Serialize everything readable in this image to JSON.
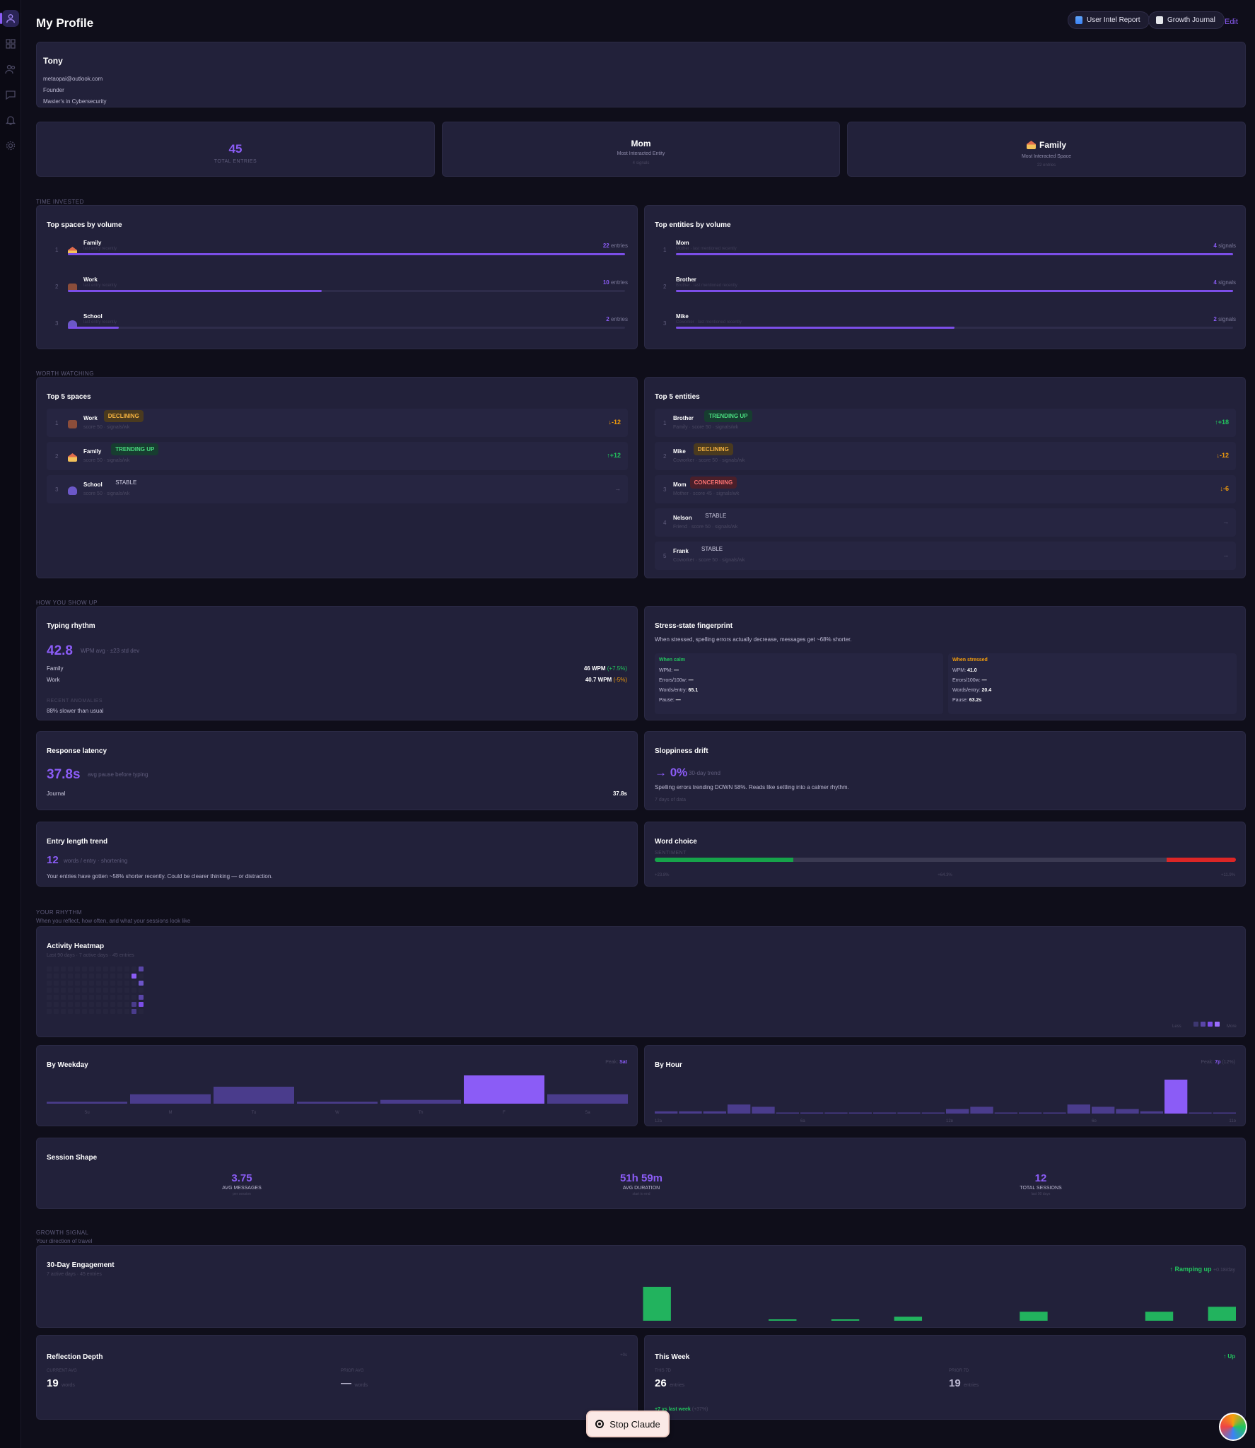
{
  "header": {
    "title": "My Profile",
    "buttons": [
      {
        "label": "User Intel Report"
      },
      {
        "label": "Growth Journal"
      }
    ],
    "edit_label": "Edit"
  },
  "profile": {
    "name": "Tony",
    "email": "metaopai@outlook.com",
    "role": "Founder",
    "education": "Master's in Cybersecurity"
  },
  "stats": [
    {
      "value": "45",
      "label": "TOTAL ENTRIES",
      "sub": ""
    },
    {
      "value": "Mom",
      "label": "Most Interacted Entity",
      "sub": "4 signals"
    },
    {
      "value": "Family",
      "label": "Most Interacted Space",
      "sub": "22 entries"
    }
  ],
  "time_invested": {
    "section_label": "TIME INVESTED",
    "spaces": {
      "title": "Top spaces by volume",
      "items": [
        {
          "rank": "1",
          "name": "Family",
          "sub": "last entry recently",
          "count": "22",
          "unit": "entries",
          "fraction": 1.0
        },
        {
          "rank": "2",
          "name": "Work",
          "sub": "last entry recently",
          "count": "10",
          "unit": "entries",
          "fraction": 0.455
        },
        {
          "rank": "3",
          "name": "School",
          "sub": "last entry recently",
          "count": "2",
          "unit": "entries",
          "fraction": 0.091
        }
      ]
    },
    "entities": {
      "title": "Top entities by volume",
      "items": [
        {
          "rank": "1",
          "name": "Mom",
          "sub": "Mother · last mentioned recently",
          "count": "4",
          "unit": "signals",
          "fraction": 1.0
        },
        {
          "rank": "2",
          "name": "Brother",
          "sub": "Brother · last mentioned recently",
          "count": "4",
          "unit": "signals",
          "fraction": 1.0
        },
        {
          "rank": "3",
          "name": "Mike",
          "sub": "Coworker · last mentioned recently",
          "count": "2",
          "unit": "signals",
          "fraction": 0.5
        }
      ]
    }
  },
  "worth_watching": {
    "section_label": "WORTH WATCHING",
    "spaces": {
      "title": "Top 5 spaces",
      "items": [
        {
          "rank": "1",
          "name": "Work",
          "status": "DECLINING",
          "sub": "score 50 · signals/wk",
          "delta": "↓-12",
          "tone": "orange"
        },
        {
          "rank": "2",
          "name": "Family",
          "status": "TRENDING UP",
          "sub": "score 50 · signals/wk",
          "delta": "↑+12",
          "tone": "green"
        },
        {
          "rank": "3",
          "name": "School",
          "status": "STABLE",
          "sub": "score 50 · signals/wk",
          "delta": "→",
          "tone": "muted"
        }
      ]
    },
    "entities": {
      "title": "Top 5 entities",
      "items": [
        {
          "rank": "1",
          "name": "Brother",
          "status": "TRENDING UP",
          "sub": "Family · score 50 · signals/wk",
          "delta": "↑+18",
          "tone": "green"
        },
        {
          "rank": "2",
          "name": "Mike",
          "status": "DECLINING",
          "sub": "Coworker · score 50 · signals/wk",
          "delta": "↓-12",
          "tone": "orange"
        },
        {
          "rank": "3",
          "name": "Mom",
          "status": "CONCERNING",
          "sub": "Mother · score 45 · signals/wk",
          "delta": "↓-6",
          "tone": "orange"
        },
        {
          "rank": "4",
          "name": "Nelson",
          "status": "STABLE",
          "sub": "Friend · score 50 · signals/wk",
          "delta": "→",
          "tone": "muted"
        },
        {
          "rank": "5",
          "name": "Frank",
          "status": "STABLE",
          "sub": "Coworker · score 50 · signals/wk",
          "delta": "→",
          "tone": "muted"
        }
      ]
    }
  },
  "how_you_show_up": {
    "section_label": "HOW YOU SHOW UP",
    "typing": {
      "title": "Typing rhythm",
      "value": "42.8",
      "unit": "WPM avg · ±23 std dev",
      "rows": [
        {
          "label": "Family",
          "value": "46 WPM",
          "delta": "(+7.5%)",
          "tone": "green"
        },
        {
          "label": "Work",
          "value": "40.7 WPM",
          "delta": "(-5%)",
          "tone": "orange"
        }
      ],
      "anomalies_label": "RECENT ANOMALIES",
      "anomaly": "88% slower than usual"
    },
    "stress": {
      "title": "Stress-state fingerprint",
      "summary": "When stressed, spelling errors actually decrease, messages get ~68% shorter.",
      "calm": {
        "label": "When calm",
        "rows": [
          {
            "k": "WPM:",
            "v": "—"
          },
          {
            "k": "Errors/100w:",
            "v": "—"
          },
          {
            "k": "Words/entry:",
            "v": "65.1"
          },
          {
            "k": "Pause:",
            "v": "—"
          }
        ]
      },
      "stressed": {
        "label": "When stressed",
        "rows": [
          {
            "k": "WPM:",
            "v": "41.0"
          },
          {
            "k": "Errors/100w:",
            "v": "—"
          },
          {
            "k": "Words/entry:",
            "v": "20.4"
          },
          {
            "k": "Pause:",
            "v": "63.2s"
          }
        ]
      }
    },
    "latency": {
      "title": "Response latency",
      "value": "37.8s",
      "unit": "avg pause before typing",
      "row_label": "Journal",
      "row_value": "37.8s"
    },
    "sloppiness": {
      "title": "Sloppiness drift",
      "value": "→ 0%",
      "unit": "30-day trend",
      "text": "Spelling errors trending DOWN 58%. Reads like settling into a calmer rhythm.",
      "foot": "7 days of data"
    },
    "entry_length": {
      "title": "Entry length trend",
      "value": "12",
      "unit": "words / entry · shortening",
      "text": "Your entries have gotten ~58% shorter recently. Could be clearer thinking — or distraction."
    },
    "word_choice": {
      "title": "Word choice",
      "sentiment_label": "SENTIMENT",
      "segments": [
        {
          "fraction": 0.238,
          "color": "#16a34a"
        },
        {
          "fraction": 0.643,
          "color": "#3b3a52"
        },
        {
          "fraction": 0.119,
          "color": "#dc2626"
        }
      ],
      "labels": [
        "+23.8%",
        "+64.3%",
        "+11.9%"
      ]
    }
  },
  "rhythm": {
    "section_label": "YOUR RHYTHM",
    "section_sub": "When you reflect, how often, and what your sessions look like",
    "heatmap": {
      "title": "Activity Heatmap",
      "sub": "Last 90 days · 7 active days · 45 entries",
      "legend_less": "Less",
      "legend_more": "More"
    },
    "weekday": {
      "title": "By Weekday",
      "peak_label": "Peak:",
      "peak_value": "Sat",
      "values": [
        1,
        5,
        9,
        1,
        2,
        15,
        5
      ],
      "labels": [
        "Su",
        "M",
        "Tu",
        "W",
        "Th",
        "F",
        "Sa"
      ],
      "highlight": 5
    },
    "hour": {
      "title": "By Hour",
      "peak_label": "Peak:",
      "peak_value": "7p",
      "peak_sub": "(12%)",
      "values": [
        1,
        1,
        1,
        4,
        3,
        0,
        0,
        0,
        0,
        0,
        0,
        0,
        2,
        3,
        0,
        0,
        0,
        4,
        3,
        2,
        1,
        15,
        0,
        0
      ],
      "highlight": 19,
      "labels": [
        "12a",
        "6a",
        "12p",
        "6p",
        "11p"
      ]
    },
    "session": {
      "title": "Session Shape",
      "items": [
        {
          "value": "3.75",
          "label": "AVG MESSAGES",
          "sub": "per session"
        },
        {
          "value": "51h 59m",
          "label": "AVG DURATION",
          "sub": "start to end"
        },
        {
          "value": "12",
          "label": "TOTAL SESSIONS",
          "sub": "last 90 days"
        }
      ]
    }
  },
  "growth": {
    "section_label": "GROWTH SIGNAL",
    "section_sub": "Your direction of travel",
    "engagement": {
      "title": "30-Day Engagement",
      "sub": "7 active days · 45 entries",
      "status": "↑ Ramping up",
      "status_sub": "+0.18/day",
      "values": [
        0,
        0,
        0,
        0,
        0,
        0,
        0,
        0,
        0,
        0,
        0,
        0,
        0,
        0,
        0,
        0,
        0,
        0,
        0,
        17,
        0,
        0,
        0,
        0.7,
        0,
        0.7,
        0,
        2,
        0,
        0,
        0,
        4.5,
        0,
        0,
        0,
        4.5,
        0,
        7
      ]
    },
    "reflection": {
      "title": "Reflection Depth",
      "badge": "+0s",
      "current_label": "CURRENT AVG",
      "current_value": "19",
      "current_unit": "words",
      "prior_label": "PRIOR AVG",
      "prior_value": "—",
      "prior_unit": "words"
    },
    "week": {
      "title": "This Week",
      "status": "↑ Up",
      "this_label": "THIS 7D",
      "this_value": "26",
      "this_unit": "entries",
      "prior_label": "PRIOR 7D",
      "prior_value": "19",
      "prior_unit": "entries",
      "delta": "+7 vs last week",
      "delta_pct": "(+37%)"
    }
  },
  "footer": {
    "stop_label": "Stop Claude"
  }
}
